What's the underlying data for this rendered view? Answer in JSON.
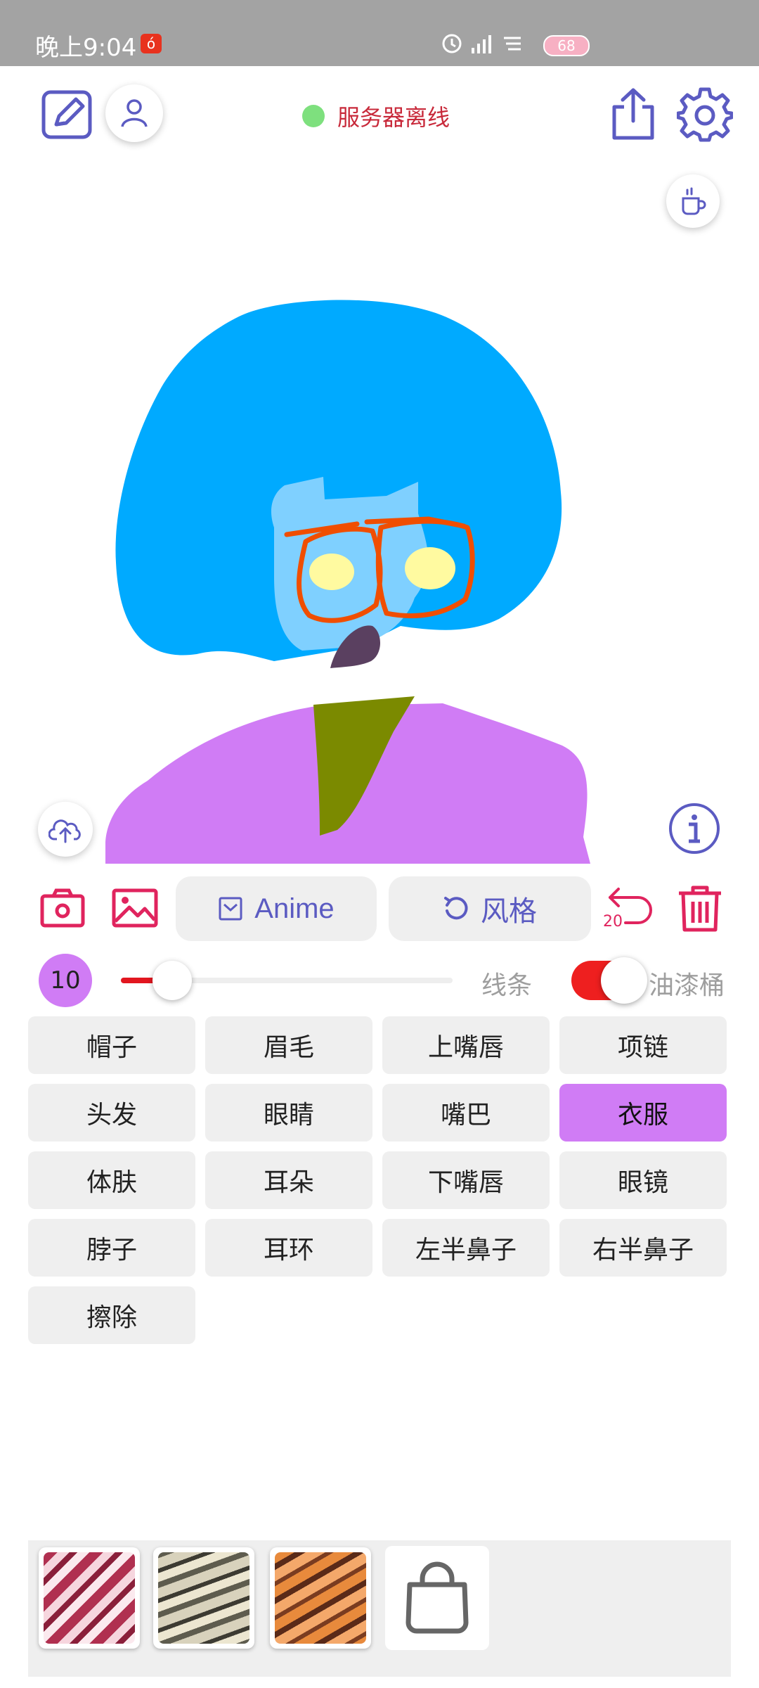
{
  "status_bar": {
    "time": "晚上9:04",
    "app_badge": "ó",
    "battery": "68"
  },
  "header": {
    "server_status": "服务器离线"
  },
  "tools": {
    "anime_label": "Anime",
    "style_label": "风格",
    "undo_count": "20"
  },
  "brush": {
    "size": "10",
    "size_fraction": 0.1,
    "lines_label": "线条",
    "bucket_label": "油漆桶",
    "bucket_enabled": true
  },
  "parts": [
    {
      "label": "帽子",
      "selected": false
    },
    {
      "label": "眉毛",
      "selected": false
    },
    {
      "label": "上嘴唇",
      "selected": false
    },
    {
      "label": "项链",
      "selected": false
    },
    {
      "label": "头发",
      "selected": false
    },
    {
      "label": "眼睛",
      "selected": false
    },
    {
      "label": "嘴巴",
      "selected": false
    },
    {
      "label": "衣服",
      "selected": true
    },
    {
      "label": "体肤",
      "selected": false
    },
    {
      "label": "耳朵",
      "selected": false
    },
    {
      "label": "下嘴唇",
      "selected": false
    },
    {
      "label": "眼镜",
      "selected": false
    },
    {
      "label": "脖子",
      "selected": false
    },
    {
      "label": "耳环",
      "selected": false
    },
    {
      "label": "左半鼻子",
      "selected": false
    },
    {
      "label": "右半鼻子",
      "selected": false
    },
    {
      "label": "擦除",
      "selected": false
    }
  ],
  "colors": {
    "accent_purple": "#5b5bc2",
    "selected_part": "#d07cf5",
    "danger_pink": "#e0245e",
    "hair": "#00aaff",
    "skin": "#7fd0ff",
    "clothes": "#d07cf5",
    "neck": "#7b8a00",
    "glasses": "#f04e00",
    "eyes": "#fffaa0",
    "mouth": "#5a4060"
  },
  "style_thumbnails": [
    "pink-marble-style",
    "gray-marble-style",
    "orange-tiger-style",
    "shop-bag-icon"
  ]
}
